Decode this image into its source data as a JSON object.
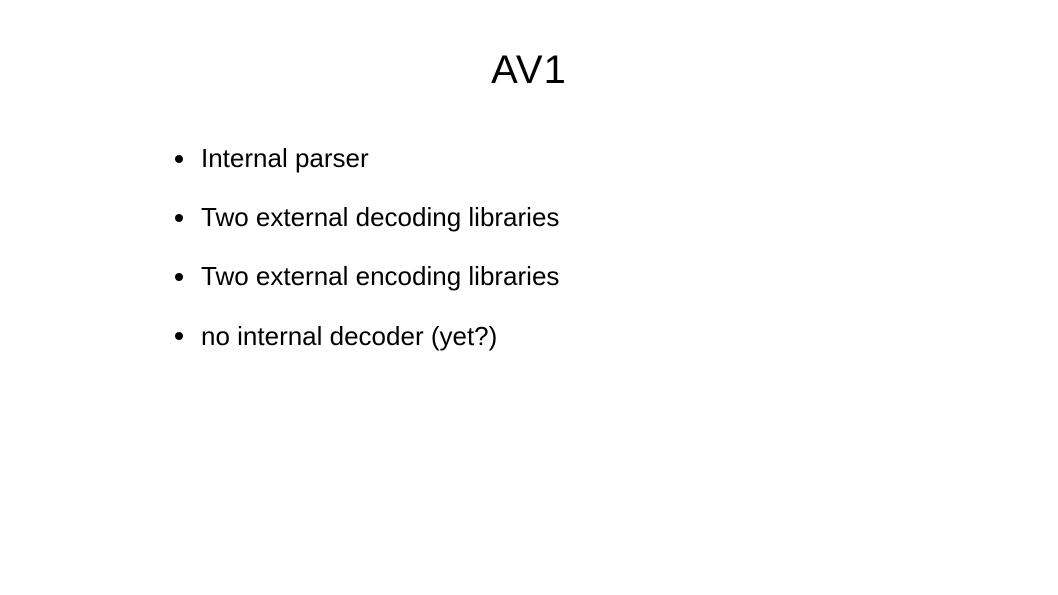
{
  "slide": {
    "title": "AV1",
    "bullets": [
      "Internal parser",
      "Two external decoding libraries",
      "Two external encoding libraries",
      "no internal decoder (yet?)"
    ]
  }
}
